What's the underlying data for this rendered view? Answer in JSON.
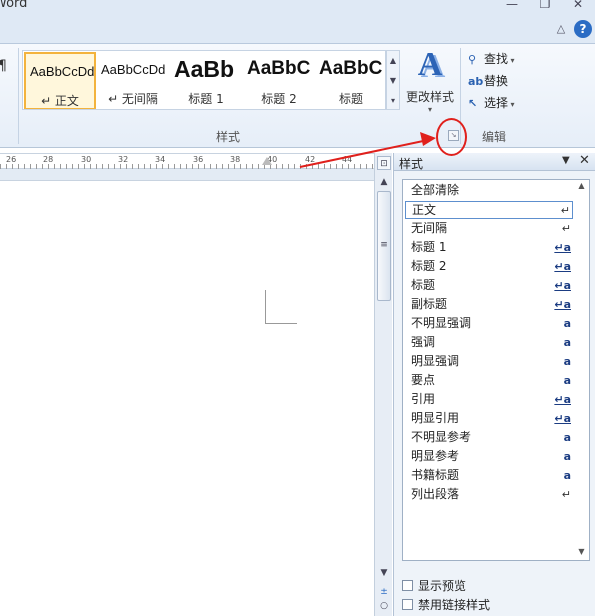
{
  "app": {
    "title": "Word"
  },
  "window": {
    "minimize": "—",
    "restore": "❐",
    "close": "✕"
  },
  "tabstrip": {
    "collapse": "△",
    "help": "?"
  },
  "styles_group": {
    "label": "样式",
    "tiles": [
      {
        "sample": "AaBbCcDd",
        "label": "↵ 正文",
        "selected": true
      },
      {
        "sample": "AaBbCcDd",
        "label": "↵ 无间隔",
        "selected": false
      },
      {
        "sample": "AaBb",
        "label": "标题 1",
        "selected": false
      },
      {
        "sample": "AaBbC",
        "label": "标题 2",
        "selected": false
      },
      {
        "sample": "AaBbC",
        "label": "标题",
        "selected": false
      }
    ],
    "change_styles": {
      "icon_glyph": "A",
      "label": "更改样式",
      "arrow": "▾"
    }
  },
  "editing_group": {
    "label": "编辑",
    "find": "查找",
    "replace": "替换",
    "select": "选择"
  },
  "ruler": {
    "numbers": [
      "26",
      "28",
      "30",
      "32",
      "34",
      "36",
      "38",
      "40",
      "42",
      "44"
    ]
  },
  "styles_pane": {
    "title": "样式",
    "items": [
      {
        "label": "全部清除",
        "marker": "",
        "selected": false
      },
      {
        "label": "正文",
        "marker": "↵",
        "selected": true
      },
      {
        "label": "无间隔",
        "marker": "↵",
        "selected": false
      },
      {
        "label": "标题 1",
        "marker": "↵a",
        "selected": false
      },
      {
        "label": "标题 2",
        "marker": "↵a",
        "selected": false
      },
      {
        "label": "标题",
        "marker": "↵a",
        "selected": false
      },
      {
        "label": "副标题",
        "marker": "↵a",
        "selected": false
      },
      {
        "label": "不明显强调",
        "marker": "a",
        "selected": false
      },
      {
        "label": "强调",
        "marker": "a",
        "selected": false
      },
      {
        "label": "明显强调",
        "marker": "a",
        "selected": false
      },
      {
        "label": "要点",
        "marker": "a",
        "selected": false
      },
      {
        "label": "引用",
        "marker": "↵a",
        "selected": false
      },
      {
        "label": "明显引用",
        "marker": "↵a",
        "selected": false
      },
      {
        "label": "不明显参考",
        "marker": "a",
        "selected": false
      },
      {
        "label": "明显参考",
        "marker": "a",
        "selected": false
      },
      {
        "label": "书籍标题",
        "marker": "a",
        "selected": false
      },
      {
        "label": "列出段落",
        "marker": "↵",
        "selected": false
      }
    ],
    "show_preview": "显示预览",
    "disable_linked": "禁用链接样式"
  },
  "colors": {
    "annotation": "#e0201c",
    "selected_tile": "#f3b33d",
    "accent": "#2d64b6"
  }
}
